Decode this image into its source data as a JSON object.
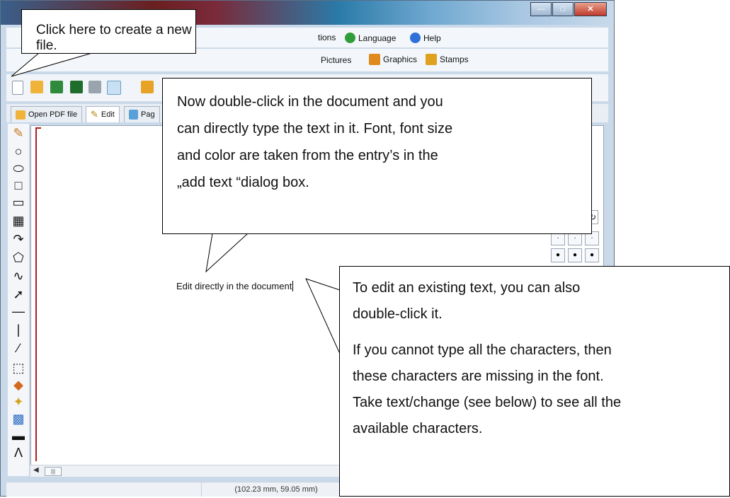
{
  "menu": {
    "items": [
      {
        "label": "tions",
        "icon": "options-icon",
        "color": "#4a8fd6"
      },
      {
        "label": "Language",
        "icon": "globe-icon",
        "color": "#2f9e3a"
      },
      {
        "label": "Help",
        "icon": "help-icon",
        "color": "#2e6fd8"
      }
    ]
  },
  "ribbon": {
    "items": [
      {
        "label": "Pictures",
        "icon": "pictures-icon"
      },
      {
        "label": "Graphics",
        "icon": "graphics-icon",
        "color": "#e08a1e"
      },
      {
        "label": "Stamps",
        "icon": "stamps-icon",
        "color": "#e0a11e"
      }
    ]
  },
  "tabs": [
    {
      "label": "Open PDF file",
      "icon": "open-folder-icon"
    },
    {
      "label": "Edit",
      "icon": "pencil-icon"
    },
    {
      "label": "Pag",
      "icon": "page-icon"
    }
  ],
  "document": {
    "text": "Edit directly in the document"
  },
  "right_panel": {
    "label_fragment": ":",
    "spinner_value": "↻"
  },
  "status": {
    "coordinates": "(102.23 mm, 59.05 mm)"
  },
  "callouts": {
    "new_file": "Click here to create a new file.",
    "double_click_lines": [
      "Now double-click in the document and you",
      "can directly type the text in it. Font, font size",
      "and color are taken from the entry’s in the",
      "„add text “dialog box."
    ],
    "edit_existing_p1_lines": [
      "To edit an existing text, you can also",
      "double-click it."
    ],
    "edit_existing_p2_lines": [
      "If you cannot type all the characters, then",
      "these characters are missing in the font.",
      "Take text/change (see below) to see all the",
      "available characters."
    ]
  }
}
